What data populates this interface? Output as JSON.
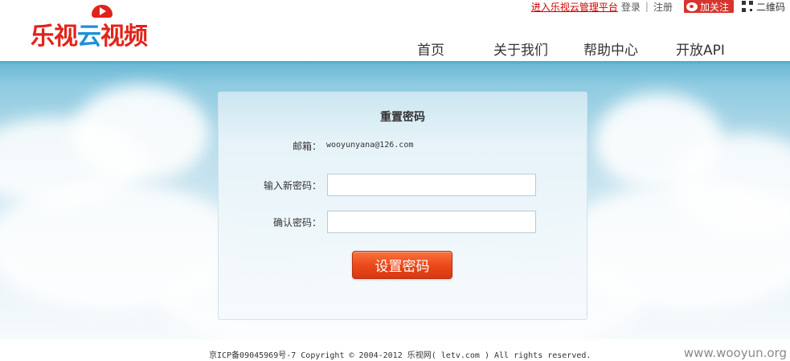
{
  "header": {
    "logo_text_le_shi": "乐视",
    "logo_text_yun": "云",
    "logo_text_shi_pin": "视频",
    "admin_link": "进入乐视云管理平台",
    "login": "登录",
    "separator": "|",
    "register": "注册",
    "weibo_follow": "加关注",
    "qr_code": "二维码"
  },
  "nav": {
    "home": "首页",
    "about": "关于我们",
    "help": "帮助中心",
    "api": "开放API"
  },
  "form": {
    "title": "重置密码",
    "email_label": "邮箱：",
    "email_value": "wooyunyana@126.com",
    "new_password_label": "输入新密码：",
    "new_password_value": "",
    "confirm_password_label": "确认密码：",
    "confirm_password_value": "",
    "submit_label": "设置密码"
  },
  "footer": {
    "copyright": "京ICP备09045969号-7 Copyright © 2004-2012 乐视网( letv.com ) All rights reserved."
  },
  "watermark": "www.wooyun.org",
  "colors": {
    "brand_red": "#e2231a",
    "brand_blue": "#1e90d8",
    "button_orange": "#ec4a1c",
    "weibo_red": "#d8332e"
  },
  "icons": [
    "logo-play-icon",
    "weibo-icon",
    "qr-code-icon"
  ]
}
